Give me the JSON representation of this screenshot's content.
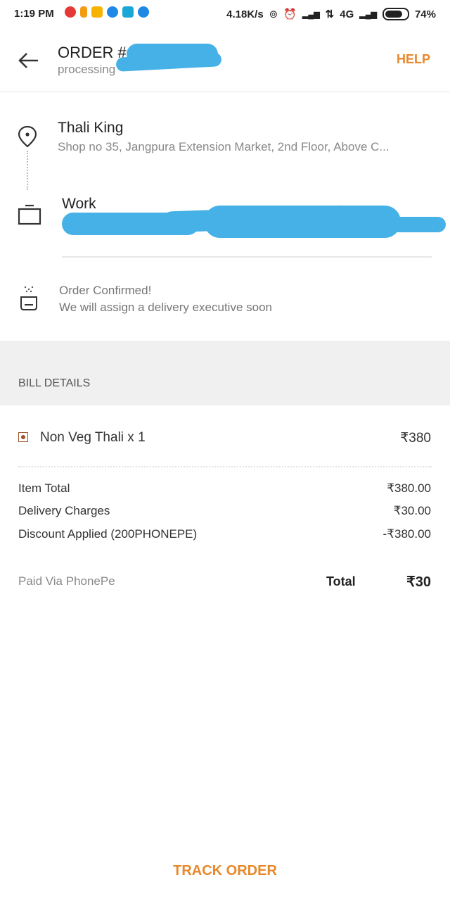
{
  "status_bar": {
    "time": "1:19 PM",
    "speed": "4.18K/s",
    "network": "4G",
    "battery": "74%"
  },
  "header": {
    "order_title": "ORDER #",
    "order_subtitle": "processing",
    "help_label": "HELP"
  },
  "restaurant": {
    "name": "Thali King",
    "address": "Shop no 35, Jangpura Extension Market, 2nd Floor, Above C..."
  },
  "delivery": {
    "label": "Work"
  },
  "order_status": {
    "line1": "Order Confirmed!",
    "line2": "We will assign a delivery executive soon"
  },
  "bill": {
    "title": "BILL DETAILS",
    "item": {
      "name": "Non Veg Thali x 1",
      "price": "₹380"
    },
    "rows": [
      {
        "label": "Item Total",
        "value": "₹380.00"
      },
      {
        "label": "Delivery Charges",
        "value": "₹30.00"
      },
      {
        "label": "Discount Applied (200PHONEPE)",
        "value": "-₹380.00"
      }
    ],
    "paid_via": "Paid Via PhonePe",
    "total_label": "Total",
    "total_value": "₹30"
  },
  "footer": {
    "track_label": "TRACK ORDER"
  },
  "colors": {
    "accent": "#e8882a",
    "redaction": "#46b1e6",
    "section_bg": "#f0f0f0"
  }
}
